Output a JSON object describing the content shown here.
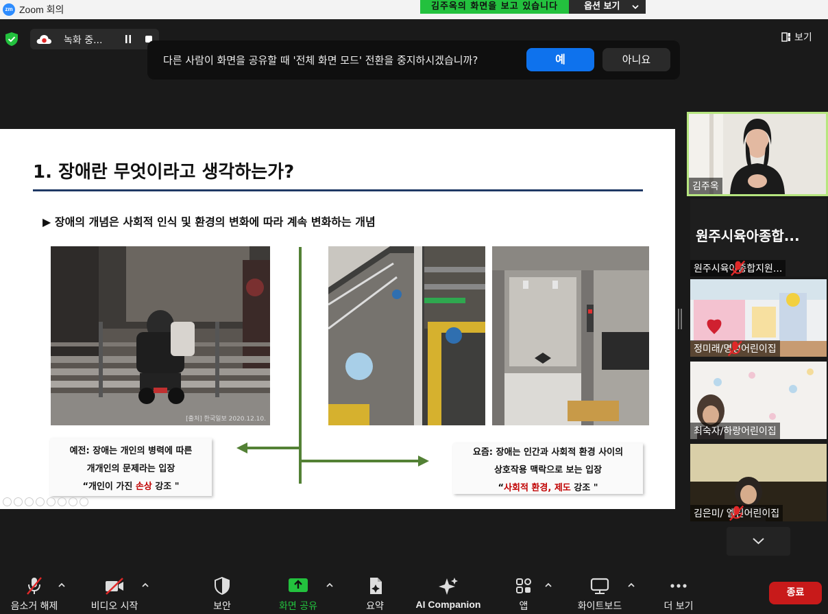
{
  "window": {
    "app_logo": "zm",
    "title": "Zoom 회의"
  },
  "share_banner": {
    "text": "김주옥의 화면을 보고 있습니다",
    "options_label": "옵션 보기"
  },
  "recording": {
    "text": "녹화 중..."
  },
  "view_button": {
    "label": "보기"
  },
  "dialog": {
    "message": "다른 사람이 화면을 공유할 때 '전체 화면 모드' 전환을 중지하시겠습니까?",
    "yes_label": "예",
    "no_label": "아니요"
  },
  "slide": {
    "title": "1. 장애란 무엇이라고 생각하는가?",
    "bullet": "▶ 장애의 개념은 사회적 인식 및 환경의 변화에 따라 계속 변화하는 개념",
    "photo_caption": "[출처] 한국일보 2020.12.10.",
    "left_note": {
      "line1": "예전: 장애는 개인의 병력에 따른",
      "line2": "개개인의 문제라는 입장",
      "line3_pre": "“개인이 가진 ",
      "line3_red": "손상",
      "line3_post": " 강조 \""
    },
    "right_note": {
      "line1": "요즘: 장애는 인간과 사회적 환경 사이의",
      "line2": "상호작용 맥락으로 보는 입장",
      "line3_pre": "“",
      "line3_red": "사회적 환경, 제도",
      "line3_post": " 강조 \""
    }
  },
  "participants": [
    {
      "name": "김주옥",
      "muted": false,
      "active": true
    },
    {
      "name": "원주시육아종합지원...",
      "display_text": "원주시육아종합...",
      "muted": true
    },
    {
      "name": "정미래/명성어린이집",
      "muted": true
    },
    {
      "name": "최숙자/하랑어린이집",
      "muted": false
    },
    {
      "name": "김은미/ 엘린어린이집",
      "muted": true
    }
  ],
  "toolbar": {
    "unmute": "음소거 해제",
    "video": "비디오 시작",
    "security": "보안",
    "share": "화면 공유",
    "summary": "요약",
    "ai": "AI Companion",
    "apps": "앱",
    "whiteboard": "화이트보드",
    "more": "더 보기",
    "end": "종료"
  },
  "colors": {
    "accent_blue": "#0e72ed",
    "share_green": "#23c13e",
    "end_red": "#c81a1a",
    "slide_green": "#538135",
    "slide_navy": "#1f3864"
  }
}
